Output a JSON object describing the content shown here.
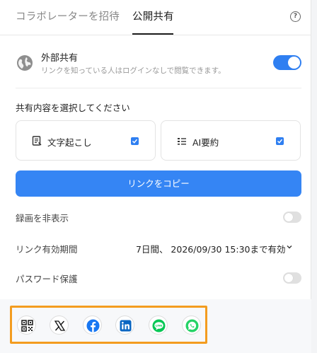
{
  "tabs": [
    {
      "label": "コラボレーターを招待"
    },
    {
      "label": "公開共有"
    }
  ],
  "external_share": {
    "title": "外部共有",
    "description": "リンクを知っている人はログインなしで閲覧できます。",
    "enabled": true
  },
  "content_select": {
    "title": "共有内容を選択してください",
    "options": [
      {
        "label": "文字起こし",
        "checked": true,
        "icon": "document-icon"
      },
      {
        "label": "AI要約",
        "checked": true,
        "icon": "list-icon"
      }
    ]
  },
  "copy_link_label": "リンクをコピー",
  "settings": {
    "hide_recording": {
      "label": "録画を非表示",
      "enabled": false
    },
    "link_expiry": {
      "label": "リンク有効期間",
      "value": "7日間、 2026/09/30 15:30まで有効"
    },
    "password": {
      "label": "パスワード保護",
      "enabled": false
    }
  },
  "share_icons": [
    "qr-code-icon",
    "x-icon",
    "facebook-icon",
    "linkedin-icon",
    "line-icon",
    "whatsapp-icon"
  ],
  "colors": {
    "accent": "#3585f4",
    "highlight": "#f39c1f",
    "facebook": "#1877f2",
    "linkedin": "#0a66c2",
    "line": "#06c755",
    "whatsapp": "#25d366"
  }
}
